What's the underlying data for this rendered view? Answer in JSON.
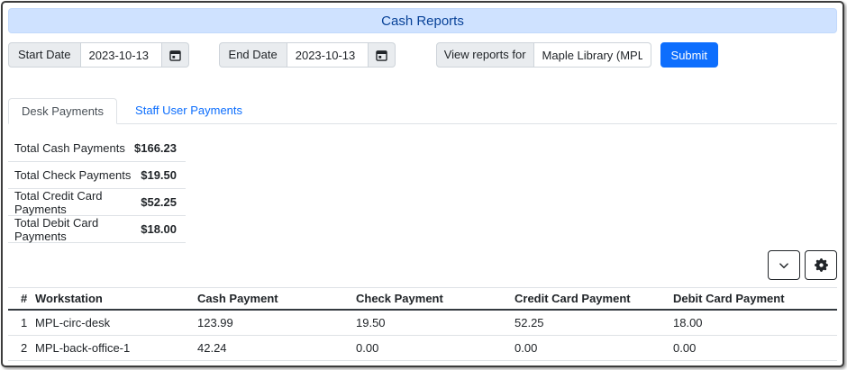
{
  "window": {
    "title": "Cash Reports"
  },
  "filters": {
    "start_date": {
      "label": "Start Date",
      "value": "2023-10-13"
    },
    "end_date": {
      "label": "End Date",
      "value": "2023-10-13"
    },
    "library": {
      "label": "View reports for",
      "value": "Maple Library (MPL)"
    },
    "submit_label": "Submit"
  },
  "tabs": {
    "desk": "Desk Payments",
    "staff": "Staff User Payments"
  },
  "summary": {
    "rows": [
      {
        "label": "Total Cash Payments",
        "value": "$166.23"
      },
      {
        "label": "Total Check Payments",
        "value": "$19.50"
      },
      {
        "label": "Total Credit Card Payments",
        "value": "$52.25"
      },
      {
        "label": "Total Debit Card Payments",
        "value": "$18.00"
      }
    ]
  },
  "grid": {
    "toolbar_icons": [
      "chevron-down-icon",
      "gear-icon"
    ],
    "columns": {
      "row_number": "#",
      "workstation": "Workstation",
      "cash": "Cash Payment",
      "check": "Check Payment",
      "credit": "Credit Card Payment",
      "debit": "Debit Card Payment"
    },
    "rows": [
      {
        "num": "1",
        "workstation": "MPL-circ-desk",
        "cash": "123.99",
        "check": "19.50",
        "credit": "52.25",
        "debit": "18.00"
      },
      {
        "num": "2",
        "workstation": "MPL-back-office-1",
        "cash": "42.24",
        "check": "0.00",
        "credit": "0.00",
        "debit": "0.00"
      }
    ]
  },
  "colors": {
    "title_bg": "#cfe2ff",
    "title_text": "#084298",
    "primary": "#0d6efd",
    "link": "#0d6efd",
    "border": "#dee2e6",
    "input_border": "#ced4da",
    "addon_bg": "#e9ecef"
  }
}
